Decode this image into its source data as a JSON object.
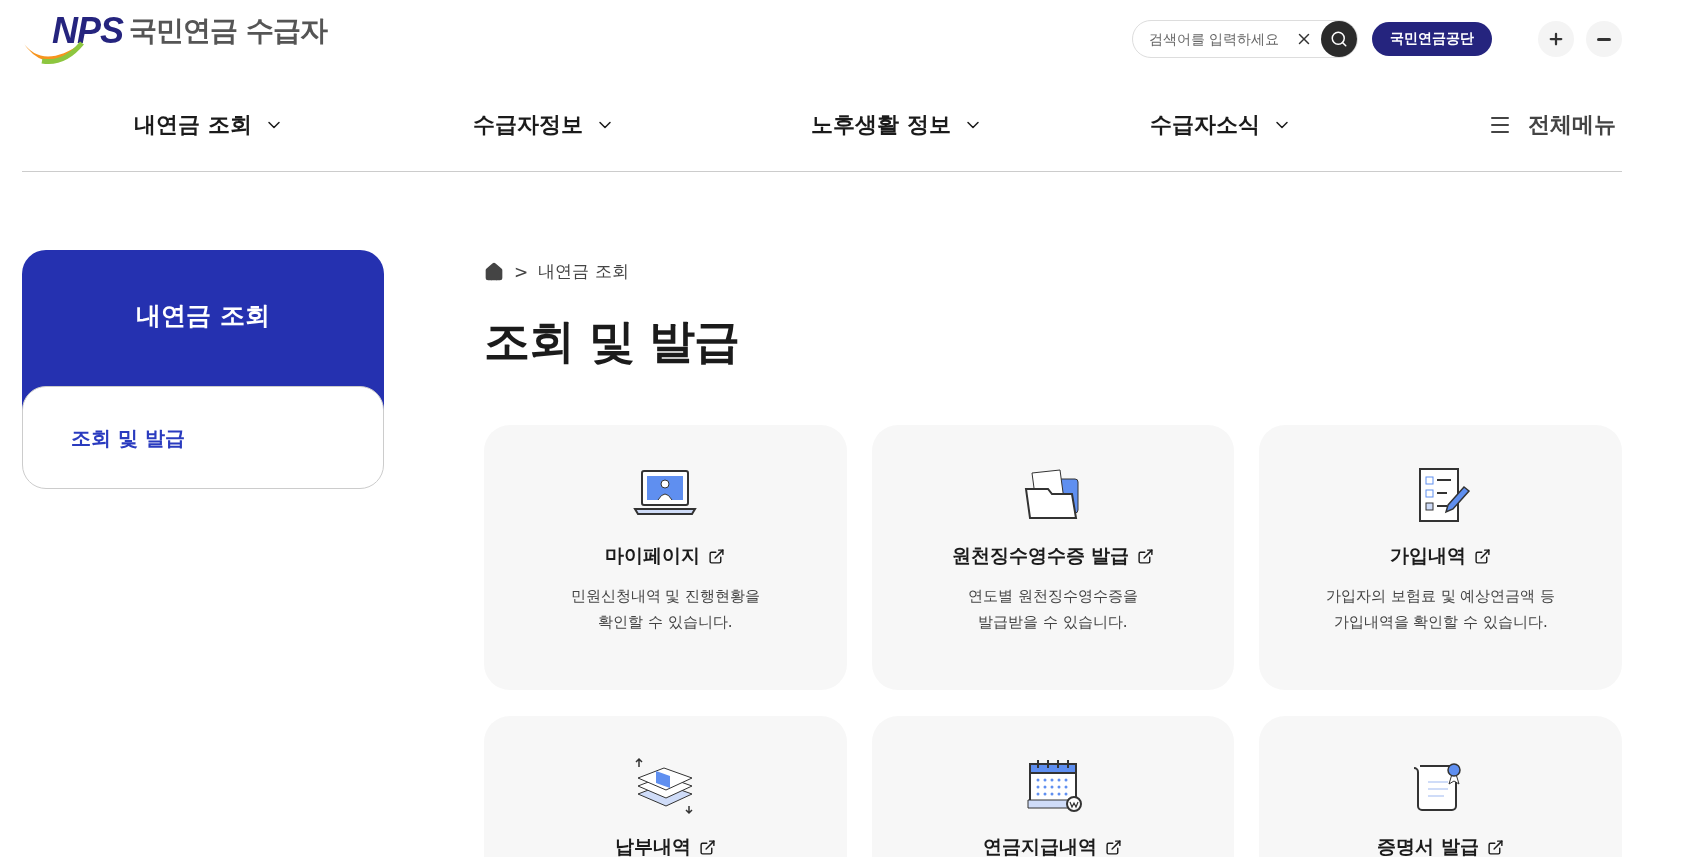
{
  "logo": {
    "mark": "NPS",
    "title": "국민연금 수급자"
  },
  "search": {
    "placeholder": "검색어를 입력하세요"
  },
  "org_button": "국민연금공단",
  "nav": [
    {
      "label": "내연금 조회"
    },
    {
      "label": "수급자정보"
    },
    {
      "label": "노후생활 정보"
    },
    {
      "label": "수급자소식"
    }
  ],
  "all_menu": "전체메뉴",
  "sidebar": {
    "title": "내연금 조회",
    "items": [
      {
        "label": "조회 및 발급",
        "selected": true
      }
    ]
  },
  "breadcrumb_separator": ">",
  "breadcrumb": [
    "내연금 조회"
  ],
  "page_title": "조회 및 발급",
  "cards": [
    {
      "kind": "laptop",
      "title": "마이페이지",
      "description": "민원신청내역 및 진행현황을\n확인할 수 있습니다."
    },
    {
      "kind": "folder",
      "title": "원천징수영수증 발급",
      "description": "연도별 원천징수영수증을\n발급받을 수 있습니다."
    },
    {
      "kind": "checklist",
      "title": "가입내역",
      "description": "가입자의 보험료 및 예상연금액 등\n가입내역을 확인할 수 있습니다."
    },
    {
      "kind": "money",
      "title": "납부내역"
    },
    {
      "kind": "calendar",
      "title": "연금지급내역"
    },
    {
      "kind": "certificate",
      "title": "증명서 발급"
    }
  ]
}
